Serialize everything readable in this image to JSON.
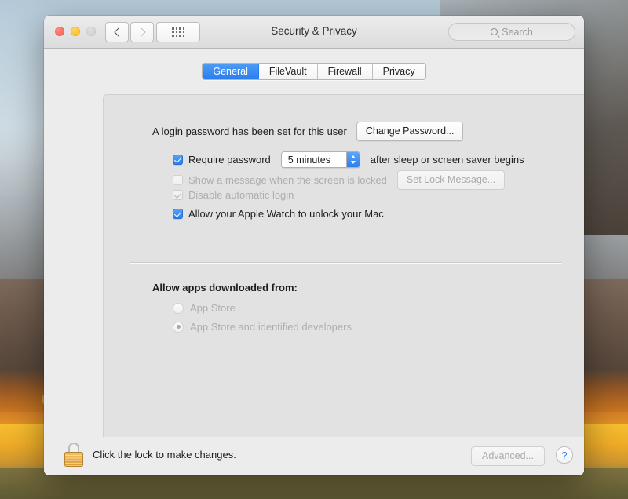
{
  "window": {
    "title": "Security & Privacy",
    "traffic_lights": [
      "close",
      "minimize",
      "zoom"
    ],
    "nav": {
      "back": "back-arrow",
      "forward": "forward-arrow"
    },
    "show_all": "grid-icon",
    "search": {
      "placeholder": "Search",
      "value": "",
      "icon": "search-icon"
    }
  },
  "tabs": [
    {
      "label": "General",
      "active": true
    },
    {
      "label": "FileVault",
      "active": false
    },
    {
      "label": "Firewall",
      "active": false
    },
    {
      "label": "Privacy",
      "active": false
    }
  ],
  "general": {
    "login_password_text": "A login password has been set for this user",
    "change_password_button": "Change Password...",
    "require_password": {
      "label": "Require password",
      "checked": true,
      "enabled": true,
      "delay_value": "5 minutes",
      "suffix": "after sleep or screen saver begins"
    },
    "show_message": {
      "label": "Show a message when the screen is locked",
      "checked": false,
      "enabled": false,
      "button": "Set Lock Message..."
    },
    "disable_auto_login": {
      "label": "Disable automatic login",
      "checked": true,
      "enabled": false
    },
    "apple_watch": {
      "label": "Allow your Apple Watch to unlock your Mac",
      "checked": true,
      "enabled": true
    },
    "allow_apps_heading": "Allow apps downloaded from:",
    "allow_apps_options": [
      {
        "label": "App Store",
        "selected": false,
        "enabled": false
      },
      {
        "label": "App Store and identified developers",
        "selected": true,
        "enabled": false
      }
    ]
  },
  "footer": {
    "lock_icon": "lock-closed-icon",
    "lock_text": "Click the lock to make changes.",
    "advanced_button": "Advanced...",
    "help_button": "?"
  },
  "colors": {
    "accent_blue": "#2b7df0",
    "window_bg": "#ececec",
    "panel_bg": "#e2e2e2",
    "disabled_text": "#aeaeae",
    "lock_gold": "#e8b04c"
  }
}
